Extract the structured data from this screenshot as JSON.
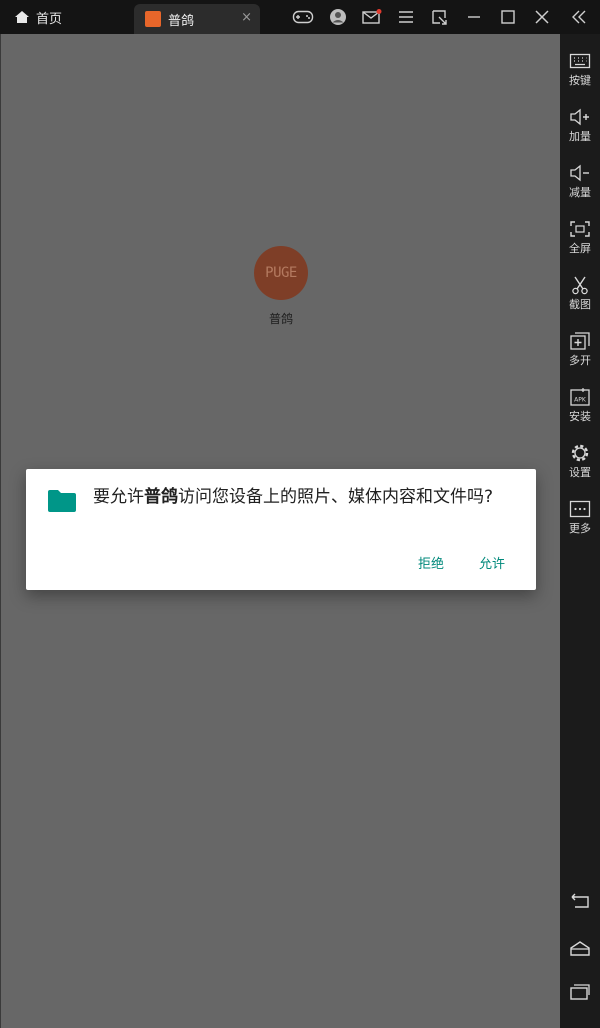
{
  "topbar": {
    "home_label": "首页",
    "tab_label": "普鸽",
    "tab_close": "×",
    "icons": [
      "gamepad-icon",
      "account-icon",
      "mail-icon",
      "menu-icon",
      "resize-icon",
      "minimize-icon",
      "maximize-icon",
      "close-icon",
      "collapse-icon"
    ]
  },
  "app": {
    "icon_text": "PUGE",
    "label": "普鸽"
  },
  "dialog": {
    "msg_prefix": "要允许",
    "app_name": "普鸽",
    "msg_suffix": "访问您设备上的照片、媒体内容和文件吗?",
    "deny_label": "拒绝",
    "allow_label": "允许",
    "accent": "#00897b"
  },
  "sidebar": {
    "items": [
      {
        "label": "按键",
        "icon": "keyboard-icon"
      },
      {
        "label": "加量",
        "icon": "volume-up-icon"
      },
      {
        "label": "减量",
        "icon": "volume-down-icon"
      },
      {
        "label": "全屏",
        "icon": "fullscreen-icon"
      },
      {
        "label": "截图",
        "icon": "scissors-icon"
      },
      {
        "label": "多开",
        "icon": "multi-instance-icon"
      },
      {
        "label": "安装",
        "icon": "apk-icon"
      },
      {
        "label": "设置",
        "icon": "gear-icon"
      },
      {
        "label": "更多",
        "icon": "more-icon"
      }
    ],
    "nav": [
      "back-icon",
      "home-icon",
      "recents-icon"
    ]
  }
}
